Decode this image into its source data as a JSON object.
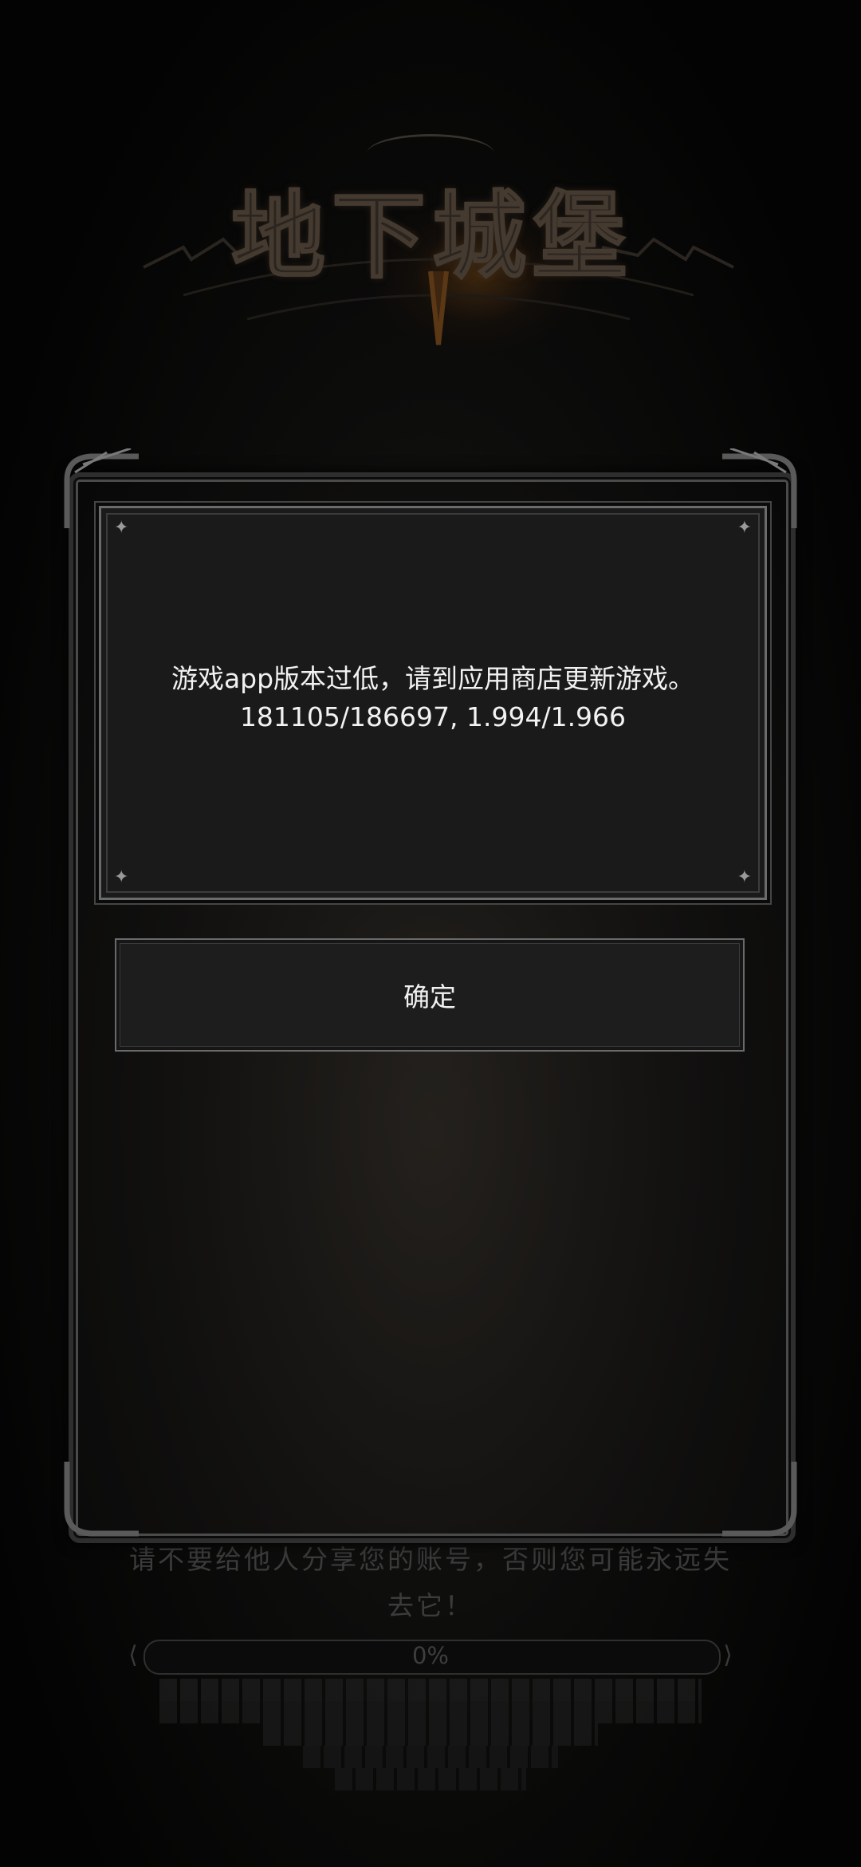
{
  "logo": {
    "title": "地下城堡"
  },
  "dialog": {
    "message_line1": "游戏app版本过低，请到应用商店更新游戏。",
    "message_line2": "181105/186697, 1.994/1.966",
    "confirm_label": "确定"
  },
  "background": {
    "warning_line1": "请不要给他人分享您的账号，否则您可能永远失",
    "warning_line2": "去它！",
    "progress": {
      "text": "0%",
      "value": 0
    }
  },
  "colors": {
    "background": "#050505",
    "panel": "#1a1a1a",
    "border": "#6b6b6b",
    "text": "#f2f2f2",
    "logo_glow": "#784614"
  }
}
